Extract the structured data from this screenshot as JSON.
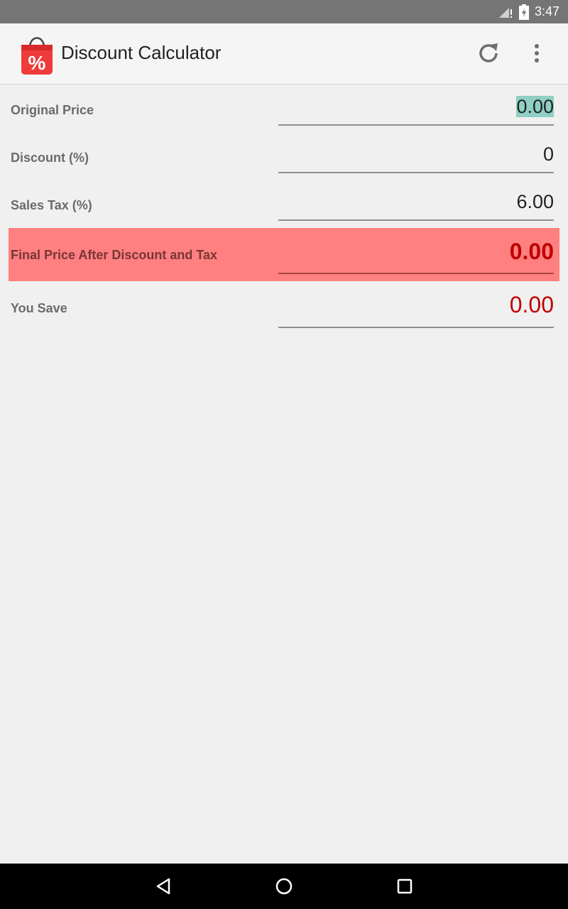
{
  "status_bar": {
    "time": "3:47",
    "icons": [
      "signal-icon",
      "battery-charging-icon"
    ]
  },
  "app_bar": {
    "title": "Discount Calculator",
    "actions": [
      "refresh",
      "more-options"
    ]
  },
  "form": {
    "original_price": {
      "label": "Original Price",
      "value": "0.00"
    },
    "discount": {
      "label": "Discount (%)",
      "value": "0"
    },
    "sales_tax": {
      "label": "Sales Tax (%)",
      "value": "6.00"
    },
    "final_price": {
      "label": "Final Price After Discount and Tax",
      "value": "0.00"
    },
    "you_save": {
      "label": "You Save",
      "value": "0.00"
    }
  },
  "colors": {
    "highlight": "#ff8080",
    "result_text": "#c00000",
    "selection": "#8fcfc4"
  },
  "nav_bar": {
    "buttons": [
      "back",
      "home",
      "recents"
    ]
  }
}
